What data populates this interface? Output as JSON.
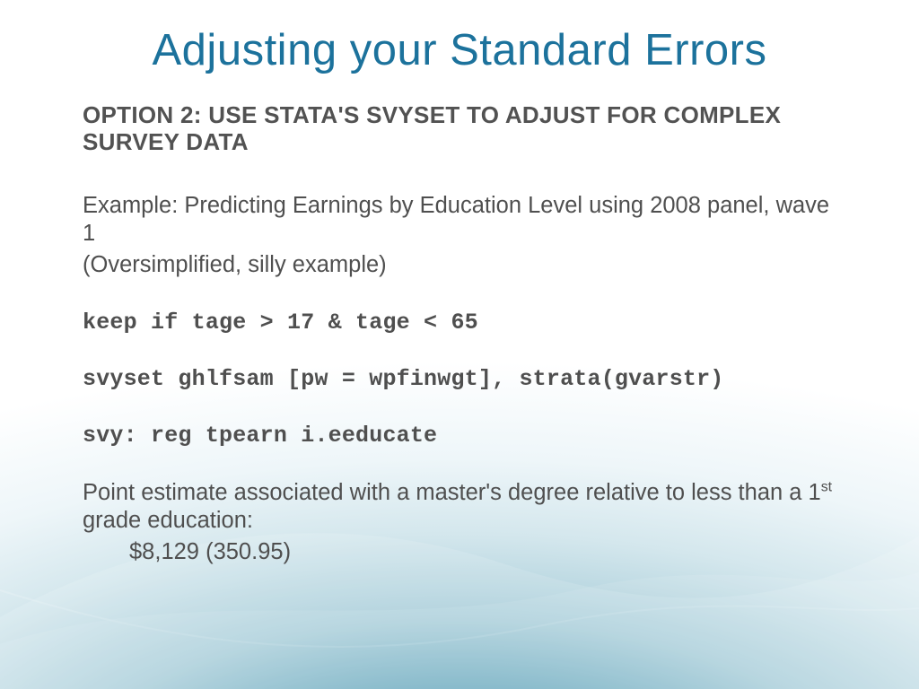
{
  "title": "Adjusting your Standard Errors",
  "subhead": "OPTION 2: USE STATA'S SVYSET TO ADJUST FOR COMPLEX SURVEY DATA",
  "example_line1": "Example: Predicting Earnings by Education Level using 2008 panel, wave 1",
  "example_line2": "(Oversimplified, silly example)",
  "code1": "keep if tage > 17 & tage < 65",
  "code2": "svyset ghlfsam [pw = wpfinwgt], strata(gvarstr)",
  "code3": "svy: reg tpearn i.eeducate",
  "estimate_label_pre": "Point estimate associated with a master's degree relative to less than a 1",
  "estimate_label_sup": "st",
  "estimate_label_post": " grade education:",
  "estimate_value": "$8,129 (350.95)"
}
